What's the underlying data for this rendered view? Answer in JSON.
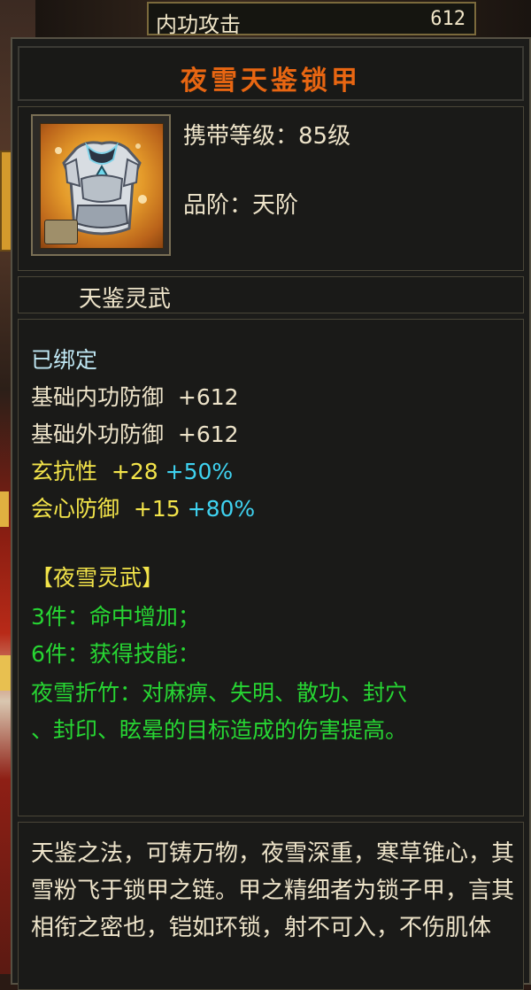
{
  "top_stat": {
    "label": "内功攻击",
    "value": "612"
  },
  "item": {
    "name": "夜雪天鉴锁甲",
    "carry_level_label": "携带等级：",
    "carry_level_value": "85级",
    "grade_label": "品阶：",
    "grade_value": "天阶",
    "series_name": "天鉴灵武",
    "icon": "armor-icon",
    "lock_icon": "lock-icon"
  },
  "stats": {
    "bound": "已绑定",
    "base_lines": [
      {
        "label": "基础内功防御",
        "value": "+612"
      },
      {
        "label": "基础外功防御",
        "value": "+612"
      }
    ],
    "bonus_lines": [
      {
        "label": "玄抗性",
        "value": "+28",
        "percent": "+50%"
      },
      {
        "label": "会心防御",
        "value": "+15",
        "percent": "+80%"
      }
    ],
    "set_title": "【夜雪灵武】",
    "set_lines": [
      "3件：命中增加；",
      "6件：获得技能："
    ],
    "skill_line1": "夜雪折竹：对麻痹、失明、散功、封穴",
    "skill_line2": "、封印、眩晕的目标造成的伤害提高。"
  },
  "description": "天鉴之法，可铸万物，夜雪深重，寒草锥心，其雪粉飞于锁甲之链。甲之精细者为锁子甲，言其相衔之密也，铠如环锁，射不可入，不伤肌体",
  "colors": {
    "title": "#e86612",
    "cream": "#ede3c9",
    "bound": "#bfe7f3",
    "yellow": "#f3e44a",
    "green": "#27d633",
    "cyan": "#3fd2f0"
  }
}
